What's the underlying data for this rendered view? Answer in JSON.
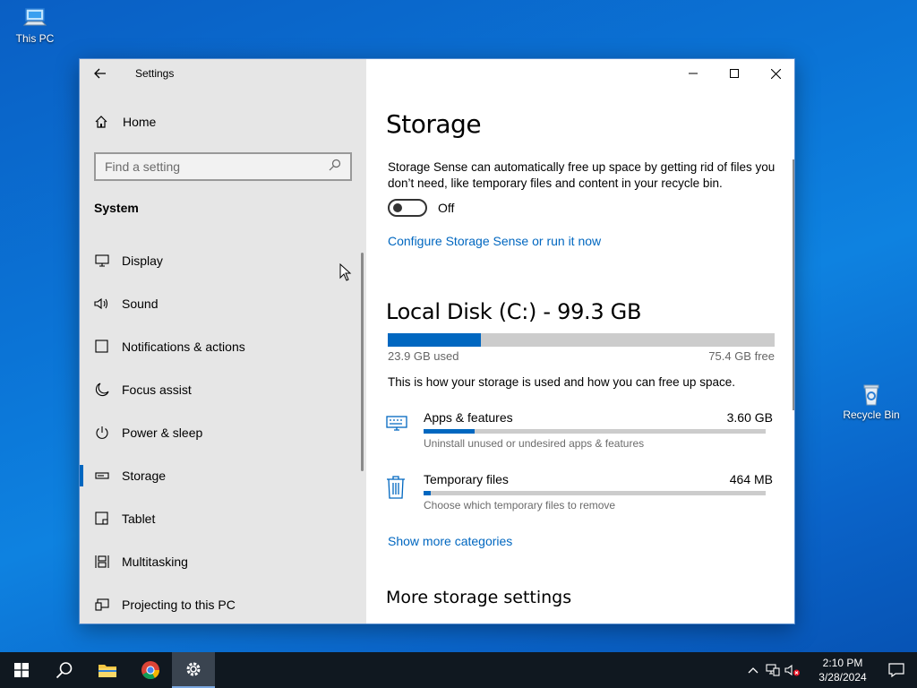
{
  "desktop": {
    "this_pc_label": "This PC",
    "recycle_bin_label": "Recycle Bin"
  },
  "window": {
    "app_title": "Settings",
    "home_label": "Home",
    "search_placeholder": "Find a setting",
    "section_label": "System",
    "nav_items": [
      {
        "label": "Display",
        "icon": "monitor-icon"
      },
      {
        "label": "Sound",
        "icon": "speaker-icon"
      },
      {
        "label": "Notifications & actions",
        "icon": "notification-icon"
      },
      {
        "label": "Focus assist",
        "icon": "moon-icon"
      },
      {
        "label": "Power & sleep",
        "icon": "power-icon"
      },
      {
        "label": "Storage",
        "icon": "storage-icon",
        "active": true
      },
      {
        "label": "Tablet",
        "icon": "tablet-icon"
      },
      {
        "label": "Multitasking",
        "icon": "multitasking-icon"
      },
      {
        "label": "Projecting to this PC",
        "icon": "projecting-icon"
      }
    ]
  },
  "storage": {
    "title": "Storage",
    "sense_description": "Storage Sense can automatically free up space by getting rid of files you don’t need, like temporary files and content in your recycle bin.",
    "toggle_state": "Off",
    "configure_link": "Configure Storage Sense or run it now",
    "disk_title": "Local Disk (C:) - 99.3 GB",
    "used_label": "23.9 GB used",
    "free_label": "75.4 GB free",
    "used_fraction": 0.24,
    "info_text": "This is how your storage is used and how you can free up space.",
    "categories": [
      {
        "name": "Apps & features",
        "size": "3.60 GB",
        "subtitle": "Uninstall unused or undesired apps & features",
        "fraction": 0.15,
        "icon": "apps-features-icon"
      },
      {
        "name": "Temporary files",
        "size": "464 MB",
        "subtitle": "Choose which temporary files to remove",
        "fraction": 0.02,
        "icon": "trash-icon"
      }
    ],
    "show_more_link": "Show more categories",
    "more_settings_title": "More storage settings"
  },
  "taskbar": {
    "time": "2:10 PM",
    "date": "3/28/2024"
  },
  "colors": {
    "accent": "#0067c0",
    "sidebar_bg": "#e6e6e6",
    "taskbar_bg": "#101820"
  }
}
